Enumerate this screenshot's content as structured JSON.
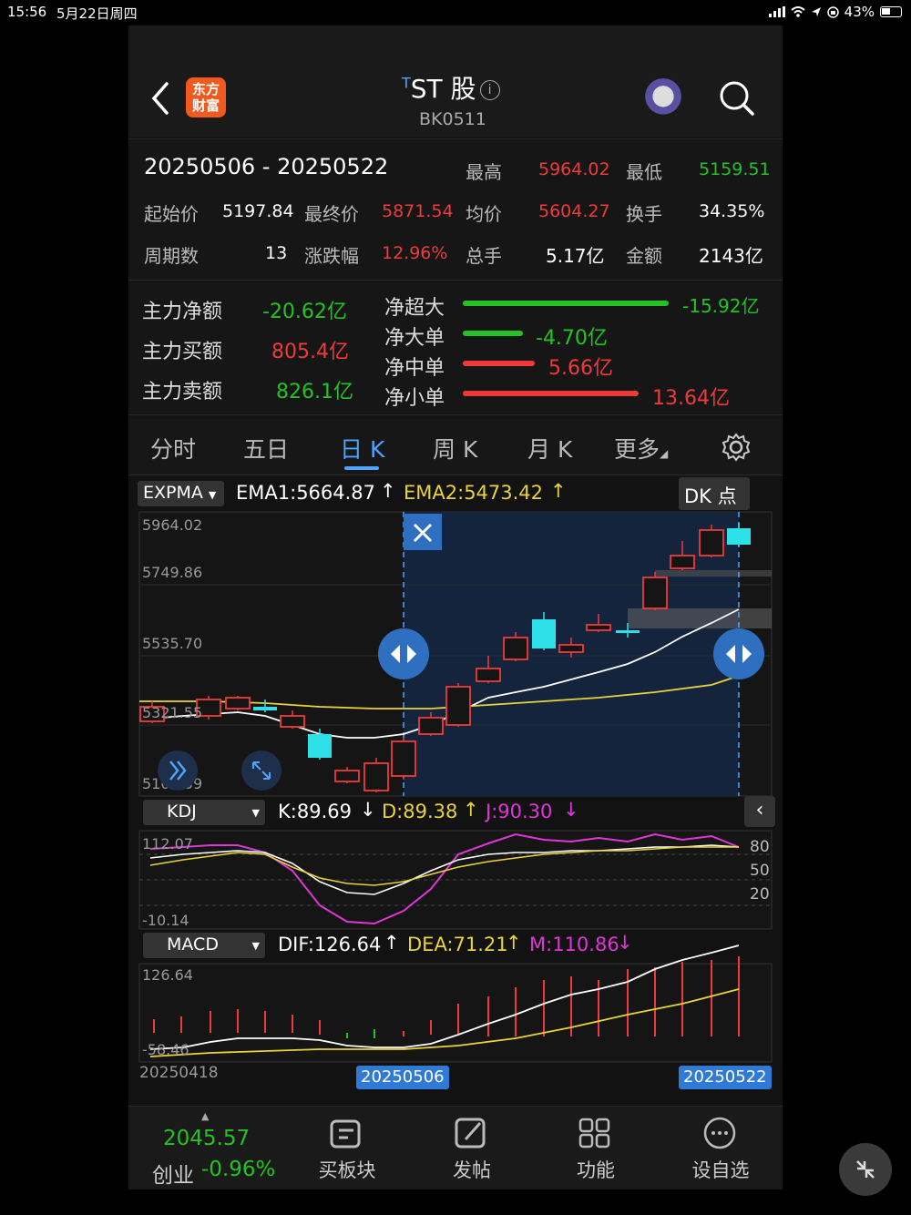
{
  "status": {
    "time": "15:56",
    "date": "5月22日周四",
    "battery": "43%"
  },
  "header": {
    "logo_text": "东方财富",
    "title_prefix": "T",
    "title": "ST 股",
    "code": "BK0511"
  },
  "summary": {
    "date_range": "20250506  -  20250522",
    "high_label": "最高",
    "high": "5964.02",
    "low_label": "最低",
    "low": "5159.51",
    "open_label": "起始价",
    "open": "5197.84",
    "close_label": "最终价",
    "close": "5871.54",
    "avg_label": "均价",
    "avg": "5604.27",
    "turnover_label": "换手",
    "turnover": "34.35%",
    "periods_label": "周期数",
    "periods": "13",
    "change_label": "涨跌幅",
    "change": "12.96%",
    "volume_label": "总手",
    "volume": "5.17亿",
    "amount_label": "金额",
    "amount": "2143亿"
  },
  "flow": {
    "net_label": "主力净额",
    "net": "-20.62亿",
    "buy_label": "主力买额",
    "buy": "805.4亿",
    "sell_label": "主力卖额",
    "sell": "826.1亿",
    "super_label": "净超大",
    "super": "-15.92亿",
    "large_label": "净大单",
    "large": "-4.70亿",
    "medium_label": "净中单",
    "medium": "5.66亿",
    "small_label": "净小单",
    "small": "13.64亿"
  },
  "tabs": [
    "分时",
    "五日",
    "日 K",
    "周 K",
    "月 K",
    "更多"
  ],
  "kchart": {
    "indicator": "EXPMA",
    "ema1": "EMA1:5664.87",
    "ema2": "EMA2:5473.42",
    "dk_label": "DK 点",
    "y_labels": [
      "5964.02",
      "5749.86",
      "5535.70",
      "5321.55",
      "5107.39"
    ]
  },
  "kdj": {
    "name": "KDJ",
    "k": "K:89.69",
    "d": "D:89.38",
    "j": "J:90.30",
    "y_top": "112.07",
    "y_bottom": "-10.14",
    "levels": [
      "80",
      "50",
      "20"
    ]
  },
  "macd": {
    "name": "MACD",
    "dif": "DIF:126.64",
    "dea": "DEA:71.21",
    "m": "M:110.86",
    "y_top": "126.64",
    "y_bottom": "-58.46"
  },
  "dates": {
    "start": "20250418",
    "sel_start": "20250506",
    "sel_end": "20250522"
  },
  "bottom": {
    "index_value": "2045.57",
    "index_name": "创业",
    "index_change": "-0.96%",
    "items": [
      "买板块",
      "发帖",
      "功能",
      "设自选"
    ]
  },
  "colors": {
    "up": "#f03a3a",
    "down": "#22c322",
    "accent": "#4fa3ff",
    "cyan": "#2ee0e8"
  }
}
